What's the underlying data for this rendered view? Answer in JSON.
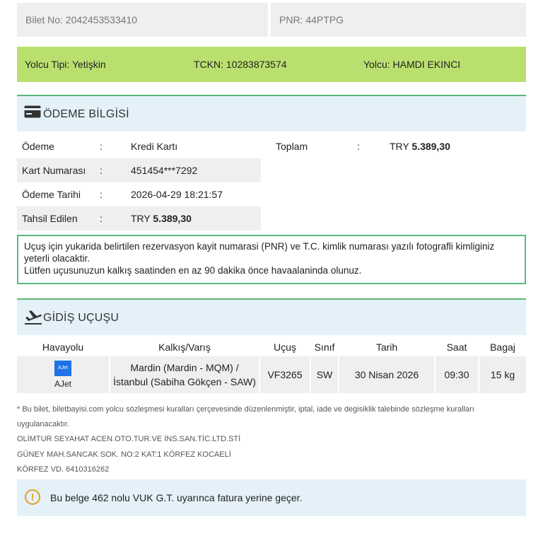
{
  "ticket": {
    "bilet_no": "Bilet No: 2042453533410",
    "pnr": "PNR: 44PTPG"
  },
  "passenger": {
    "type": "Yolcu Tipi: Yetişkin",
    "tckn": "TCKN: 10283873574",
    "name": "Yolcu: HAMDI EKINCI"
  },
  "payment": {
    "title": "ÖDEME BİLGİSİ",
    "colon": ":",
    "rows": [
      {
        "label": "Ödeme",
        "value": "Kredi Kartı"
      },
      {
        "label": "Kart Numarası",
        "value": "451454***7292"
      },
      {
        "label": "Ödeme Tarihi",
        "value": "2026-04-29 18:21:57"
      },
      {
        "label": "Tahsil Edilen",
        "currency": "TRY",
        "amount": "5.389,30"
      }
    ],
    "total_label": "Toplam",
    "total_currency": "TRY",
    "total_amount": "5.389,30"
  },
  "notice": {
    "line1": "Uçuş için yukarida belirtilen rezervasyon kayit numarasi (PNR) ve T.C. kimlik numarası yazılı fotografli kimliginiz yeterli olacaktir.",
    "line2": "Lütfen uçusunuzun kalkış saatinden en az 90 dakika önce havaalaninda olunuz."
  },
  "flight": {
    "title": "GİDİŞ UÇUŞU",
    "headers": {
      "airline": "Havayolu",
      "route": "Kalkış/Varış",
      "flight": "Uçuş",
      "class": "Sınıf",
      "date": "Tarih",
      "time": "Saat",
      "baggage": "Bagaj"
    },
    "row": {
      "logo_text": "AJet",
      "airline": "AJet",
      "route_line1": "Mardin (Mardin - MQM) /",
      "route_line2": "İstanbul (Sabiha Gökçen - SAW)",
      "flight_no": "VF3265",
      "class": "SW",
      "date": "30 Nisan 2026",
      "time": "09:30",
      "baggage": "15 kg"
    }
  },
  "footer": {
    "line1": "* Bu bilet, biletbayisi.com yolcu sözleşmesi kuralları çerçevesinde düzenlenmiştir, iptal, iade ve degisiklik talebinde sözleşme kuralları",
    "line2": "uygulanacaktır.",
    "line3": "OLİMTUR SEYAHAT ACEN.OTO.TUR.VE İNS.SAN.TİC.LTD.STİ",
    "line4": "GÜNEY MAH.SANCAK SOK. NO:2 KAT:1 KÖRFEZ KOCAELİ",
    "line5": "KÖRFEZ VD. 6410316262"
  },
  "vuk": {
    "icon_glyph": "!",
    "text": "Bu belge 462 nolu VUK G.T. uyarınca fatura yerine geçer."
  },
  "colors": {
    "passenger_bar": "#b9e06e",
    "section_head": "#e4f1f9",
    "accent_green": "#5db87a",
    "warning": "#e6a020",
    "ajet_blue": "#1e73e8"
  }
}
